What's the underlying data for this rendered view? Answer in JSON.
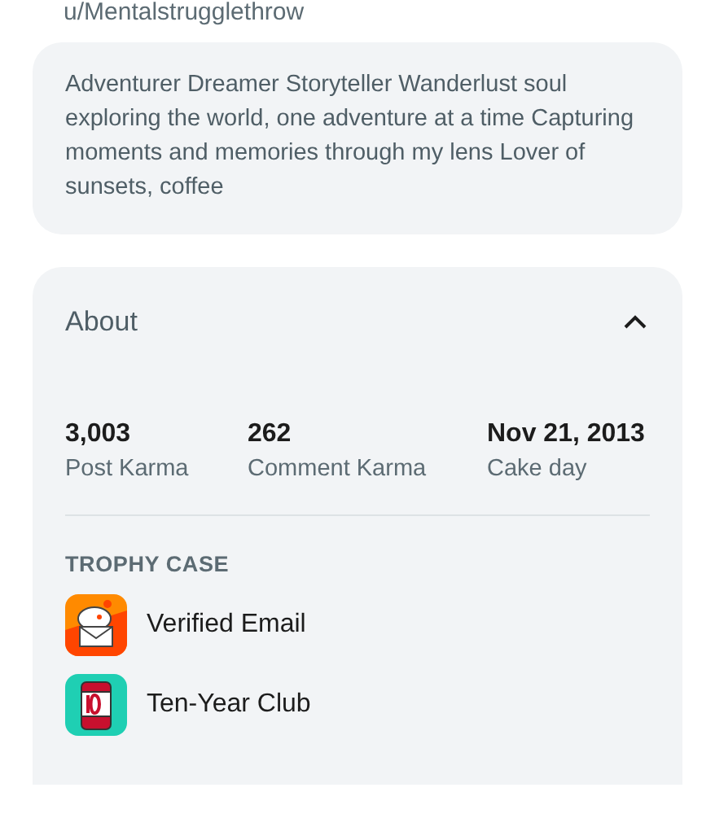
{
  "username": "u/Mentalstrugglethrow",
  "bio": "Adventurer Dreamer Storyteller Wanderlust soul exploring the world, one adventure at a time Capturing moments and memories through my lens Lover of sunsets, coffee",
  "about": {
    "title": "About",
    "expanded": true,
    "stats": [
      {
        "value": "3,003",
        "label": "Post Karma"
      },
      {
        "value": "262",
        "label": "Comment Karma"
      },
      {
        "value": "Nov 21, 2013",
        "label": "Cake day"
      }
    ],
    "trophy_heading": "TROPHY CASE",
    "trophies": [
      {
        "kind": "email",
        "name": "Verified Email"
      },
      {
        "kind": "tenyear",
        "name": "Ten-Year Club"
      }
    ]
  }
}
